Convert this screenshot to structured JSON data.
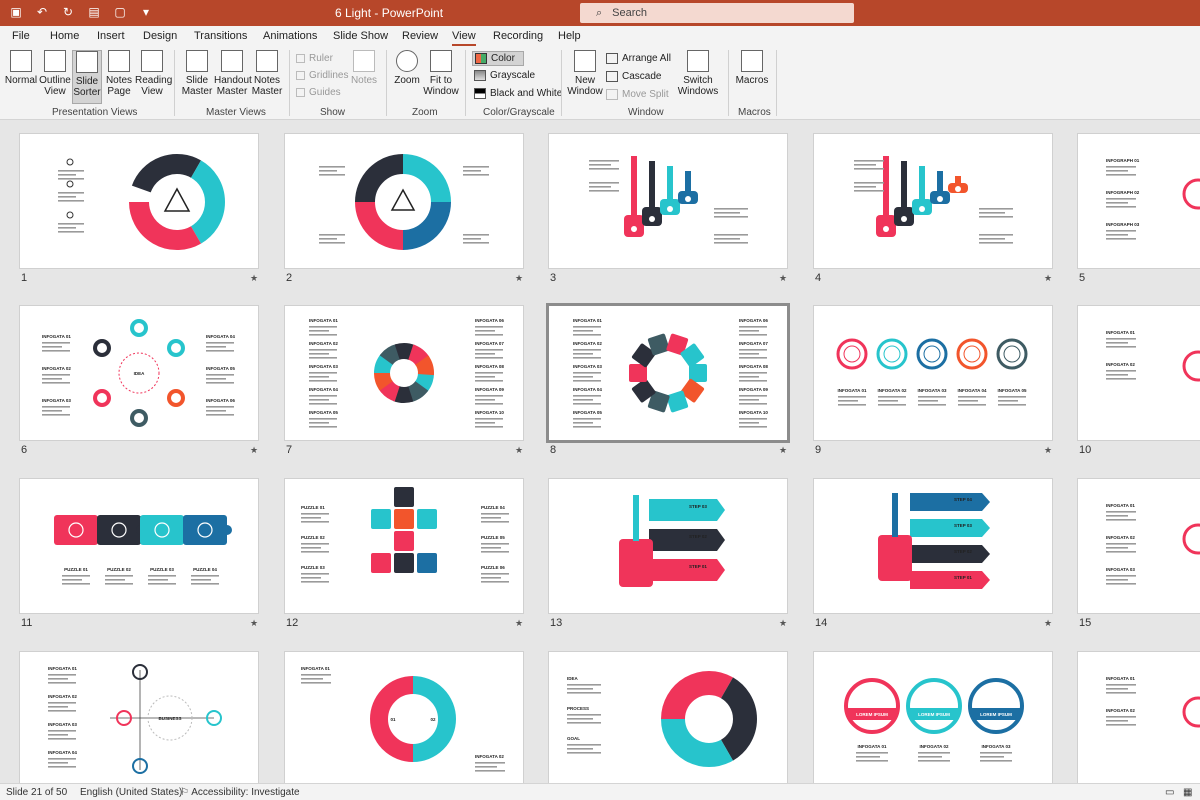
{
  "app": {
    "window_title": "6 Light  -  PowerPoint",
    "search_placeholder": "Search"
  },
  "menu": [
    "File",
    "Home",
    "Insert",
    "Design",
    "Transitions",
    "Animations",
    "Slide Show",
    "Review",
    "View",
    "Recording",
    "Help"
  ],
  "active_tab": "View",
  "ribbon": {
    "presentation_views": {
      "label": "Presentation Views",
      "normal": "Normal",
      "outline": "Outline View",
      "slide_sorter": "Slide Sorter",
      "notes_page": "Notes Page",
      "reading": "Reading View"
    },
    "master_views": {
      "label": "Master Views",
      "slide_master": "Slide Master",
      "handout_master": "Handout Master",
      "notes_master": "Notes Master"
    },
    "show": {
      "label": "Show",
      "ruler": "Ruler",
      "gridlines": "Gridlines",
      "guides": "Guides",
      "notes": "Notes"
    },
    "zoom": {
      "label": "Zoom",
      "zoom": "Zoom",
      "fit": "Fit to Window"
    },
    "color": {
      "label": "Color/Grayscale",
      "color": "Color",
      "grayscale": "Grayscale",
      "bw": "Black and White"
    },
    "window": {
      "label": "Window",
      "new_window": "New Window",
      "arrange": "Arrange All",
      "cascade": "Cascade",
      "move_split": "Move Split",
      "switch": "Switch Windows"
    },
    "macros": {
      "label": "Macros",
      "macros": "Macros"
    }
  },
  "slides": [
    {
      "n": "1",
      "star": "★",
      "kind": "puzzle-ring",
      "labels": [
        "PUZZLE 01",
        "PUZZLE 02",
        "PUZZLE 03"
      ]
    },
    {
      "n": "2",
      "star": "★",
      "kind": "puzzle-ring4",
      "labels": [
        "PUZZLE 01",
        "PUZZLE 02",
        "PUZZLE 03",
        "PUZZLE 04"
      ]
    },
    {
      "n": "3",
      "star": "★",
      "kind": "keys",
      "labels": [
        "01",
        "02",
        "03",
        "04"
      ]
    },
    {
      "n": "4",
      "star": "★",
      "kind": "keys",
      "labels": [
        "01",
        "02",
        "03",
        "04"
      ]
    },
    {
      "n": "5",
      "star": "",
      "kind": "partial",
      "labels": [
        "INFOGRAPH 01",
        "INFOGRAPH 02",
        "INFOGRAPH 03"
      ]
    },
    {
      "n": "6",
      "star": "★",
      "kind": "idea",
      "labels": [
        "INFOGATA 01",
        "INFOGATA 02",
        "INFOGATA 03",
        "INFOGATA 04",
        "INFOGATA 05",
        "INFOGATA 06",
        "IDEA"
      ]
    },
    {
      "n": "7",
      "star": "★",
      "kind": "swirl",
      "labels": [
        "INFOGATA 01",
        "INFOGATA 02",
        "INFOGATA 03",
        "INFOGATA 04",
        "INFOGATA 05",
        "INFOGATA 06",
        "INFOGATA 07",
        "INFOGATA 08",
        "INFOGATA 09",
        "INFOGATA 10"
      ]
    },
    {
      "n": "8",
      "star": "★",
      "kind": "flower",
      "labels": [
        "INFOGATA 01",
        "INFOGATA 02",
        "INFOGATA 03",
        "INFOGATA 04",
        "INFOGATA 05",
        "INFOGATA 06",
        "INFOGATA 07",
        "INFOGATA 08",
        "INFOGATA 09",
        "INFOGATA 10"
      ]
    },
    {
      "n": "9",
      "star": "★",
      "kind": "circles5",
      "labels": [
        "INFOGATA 01",
        "INFOGATA 02",
        "INFOGATA 03",
        "INFOGATA 04",
        "INFOGATA 05"
      ]
    },
    {
      "n": "10",
      "star": "",
      "kind": "partial",
      "labels": [
        "INFOGATA 01",
        "INFOGATA 02"
      ]
    },
    {
      "n": "11",
      "star": "★",
      "kind": "puzzle-row",
      "labels": [
        "PUZZLE 01",
        "PUZZLE 02",
        "PUZZLE 03",
        "PUZZLE 04"
      ]
    },
    {
      "n": "12",
      "star": "★",
      "kind": "puzzle-cross",
      "labels": [
        "PUZZLE 01",
        "PUZZLE 02",
        "PUZZLE 03",
        "PUZZLE 04",
        "PUZZLE 05",
        "PUZZLE 06"
      ]
    },
    {
      "n": "13",
      "star": "★",
      "kind": "key-steps",
      "labels": [
        "STEP 03",
        "STEP 02",
        "STEP 01"
      ]
    },
    {
      "n": "14",
      "star": "★",
      "kind": "key-steps4",
      "labels": [
        "STEP 04",
        "STEP 03",
        "STEP 02",
        "STEP 01"
      ]
    },
    {
      "n": "15",
      "star": "",
      "kind": "partial",
      "labels": [
        "INFOGATA 01",
        "INFOGATA 02",
        "INFOGATA 03"
      ]
    },
    {
      "n": "16",
      "star": "",
      "kind": "business",
      "labels": [
        "INFOGATA 01",
        "INFOGATA 02",
        "INFOGATA 03",
        "INFOGATA 04",
        "BUSINESS"
      ]
    },
    {
      "n": "17",
      "star": "",
      "kind": "ring2",
      "labels": [
        "INFOGATA 01",
        "INFOGATA 02",
        "01",
        "02"
      ]
    },
    {
      "n": "18",
      "star": "",
      "kind": "donut3",
      "labels": [
        "IDEA",
        "PROCESS",
        "GOAL"
      ]
    },
    {
      "n": "19",
      "star": "",
      "kind": "lorem3",
      "labels": [
        "LOREM IPSUM",
        "LOREM IPSUM",
        "LOREM IPSUM",
        "INFOGATA 01",
        "INFOGATA 02",
        "INFOGATA 03"
      ]
    },
    {
      "n": "20",
      "star": "",
      "kind": "partial",
      "labels": [
        "INFOGATA 01",
        "INFOGATA 02"
      ]
    }
  ],
  "colors": {
    "teal": "#27c4cc",
    "pink": "#f0345a",
    "dark": "#2b2f3a",
    "blue": "#1c6fa3",
    "orange": "#f2552c",
    "slate": "#3e5b63"
  },
  "status": {
    "slide": "Slide 21 of 50",
    "language": "English (United States)",
    "accessibility": "Accessibility: Investigate"
  }
}
